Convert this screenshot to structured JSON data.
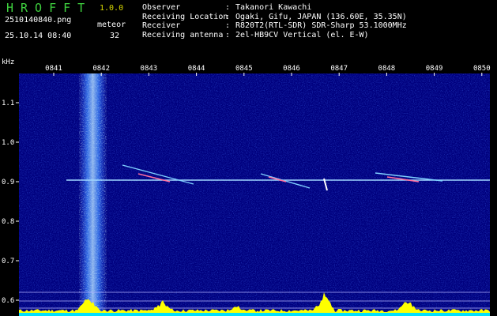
{
  "header": {
    "logo": "HROFFT",
    "version": "1.0.0",
    "filename": "2510140840.png",
    "datetime": "25.10.14 08:40",
    "meteor_label": "meteor",
    "meteor_count": "32",
    "info": [
      {
        "key": "Observer",
        "value": "Takanori Kawachi"
      },
      {
        "key": "Receiving Location",
        "value": "Ogaki, Gifu, JAPAN (136.60E, 35.35N)"
      },
      {
        "key": "Receiver",
        "value": "R820T2(RTL-SDR) SDR-Sharp 53.1000MHz"
      },
      {
        "key": "Receiving antenna",
        "value": "2el-HB9CV Vertical (el. E-W)"
      }
    ]
  },
  "spectrogram": {
    "y_unit": "kHz",
    "y_ticks": [
      "1.1",
      "1.0",
      "0.9",
      "0.8",
      "0.7",
      "0.6"
    ],
    "x_ticks": [
      "0841",
      "0842",
      "0843",
      "0844",
      "0845",
      "0846",
      "0847",
      "0848",
      "0849",
      "0850"
    ],
    "colors": {
      "background": "#00008a",
      "carrier": "#9fd6ff",
      "ticks": "#ffffff",
      "spectrum": "#ffff00",
      "baseline": "#00e0ff"
    }
  }
}
